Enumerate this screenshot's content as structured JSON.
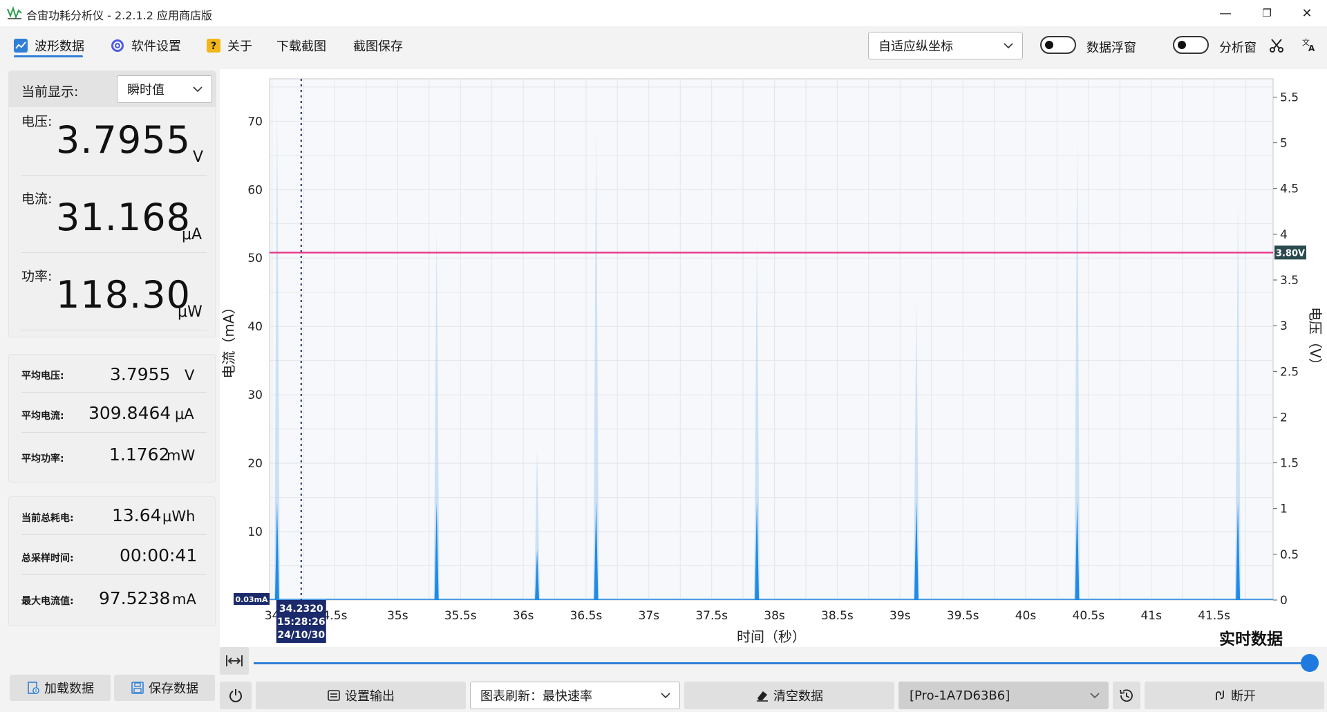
{
  "window": {
    "title": "合宙功耗分析仪 - 2.2.1.2 应用商店版",
    "minimize": "—",
    "maximize": "❐",
    "close": "✕"
  },
  "menu": {
    "items": [
      {
        "label": "波形数据",
        "icon": "waveform-icon",
        "active": true
      },
      {
        "label": "软件设置",
        "icon": "gear-icon"
      },
      {
        "label": "关于",
        "icon": "question-icon"
      },
      {
        "label": "下载截图"
      },
      {
        "label": "截图保存"
      }
    ],
    "axis_mode": "自适应纵坐标",
    "data_float_label": "数据浮窗",
    "analysis_label": "分析窗",
    "accent_color": "#2f7fd8"
  },
  "display_panel": {
    "current_display_label": "当前显示:",
    "current_display_value": "瞬时值",
    "voltage_label": "电压:",
    "voltage_value": "3.7955",
    "voltage_unit": "V",
    "current_label": "电流:",
    "current_value": "31.168",
    "current_unit": "μA",
    "power_label": "功率:",
    "power_value": "118.30",
    "power_unit": "μW"
  },
  "average_panel": {
    "avg_voltage_label": "平均电压:",
    "avg_voltage_value": "3.7955",
    "avg_voltage_unit": "V",
    "avg_current_label": "平均电流:",
    "avg_current_value": "309.8464",
    "avg_current_unit": "μA",
    "avg_power_label": "平均功率:",
    "avg_power_value": "1.1762",
    "avg_power_unit": "mW"
  },
  "total_panel": {
    "energy_label": "当前总耗电:",
    "energy_value": "13.64",
    "energy_unit": "μWh",
    "time_label": "总采样时间:",
    "time_value": "00:00:41",
    "max_label": "最大电流值:",
    "max_value": "97.5238",
    "max_unit": "mA"
  },
  "left_buttons": {
    "load": "加载数据",
    "save": "保存数据"
  },
  "chart_data": {
    "type": "line",
    "xlabel": "时间（秒）",
    "ylabel_left": "电流（mA）",
    "ylabel_right": "电压（V）",
    "realtime_label": "实时数据",
    "x_ticks": [
      "34",
      "4.5s",
      "35s",
      "35.5s",
      "36s",
      "36.5s",
      "37s",
      "37.5s",
      "38s",
      "38.5s",
      "39s",
      "39.5s",
      "40s",
      "40.5s",
      "41s",
      "41.5s"
    ],
    "xlim": [
      33.98,
      41.97
    ],
    "ylim_left": [
      0,
      76.2
    ],
    "ylim_right": [
      0,
      5.7
    ],
    "left_ticks": [
      10,
      20,
      30,
      40,
      50,
      60,
      70
    ],
    "right_ticks": [
      "0",
      "0.5",
      "1",
      "1.5",
      "2",
      "2.5",
      "3",
      "3.5",
      "4",
      "4.5",
      "5",
      "5.5"
    ],
    "right_tick_values": [
      0,
      0.5,
      1,
      1.5,
      2,
      2.5,
      3,
      3.5,
      4,
      4.5,
      5,
      5.5
    ],
    "voltage_series": {
      "name": "电压",
      "value": 3.8,
      "color": "#e83e8c"
    },
    "voltage_tag": "3.80V",
    "current_series": {
      "name": "电流",
      "color": "#1f8be8",
      "fill_color": "#a9cdf2"
    },
    "spikes": [
      {
        "x": 34.04,
        "peak_light": 72,
        "peak_core": 14.6
      },
      {
        "x": 35.31,
        "peak_light": 54,
        "peak_core": 14.3
      },
      {
        "x": 36.11,
        "peak_light": 22,
        "peak_core": 7.4
      },
      {
        "x": 36.58,
        "peak_light": 69,
        "peak_core": 14.7
      },
      {
        "x": 37.86,
        "peak_light": 53,
        "peak_core": 14.7
      },
      {
        "x": 39.13,
        "peak_light": 44,
        "peak_core": 14.7
      },
      {
        "x": 40.41,
        "peak_light": 67,
        "peak_core": 14.7
      },
      {
        "x": 41.69,
        "peak_light": 58,
        "peak_core": 14.7
      }
    ],
    "baseline_tag": "0.03mA",
    "cursor_x": 34.232,
    "cursor_tag": [
      "34.2320",
      "15:28:26",
      "24/10/30"
    ],
    "grid": true
  },
  "bottom_bar": {
    "set_output": "设置输出",
    "refresh_label": "图表刷新：最快速率",
    "clear": "清空数据",
    "device": "[Pro-1A7D63B6]",
    "disconnect": "断开"
  }
}
